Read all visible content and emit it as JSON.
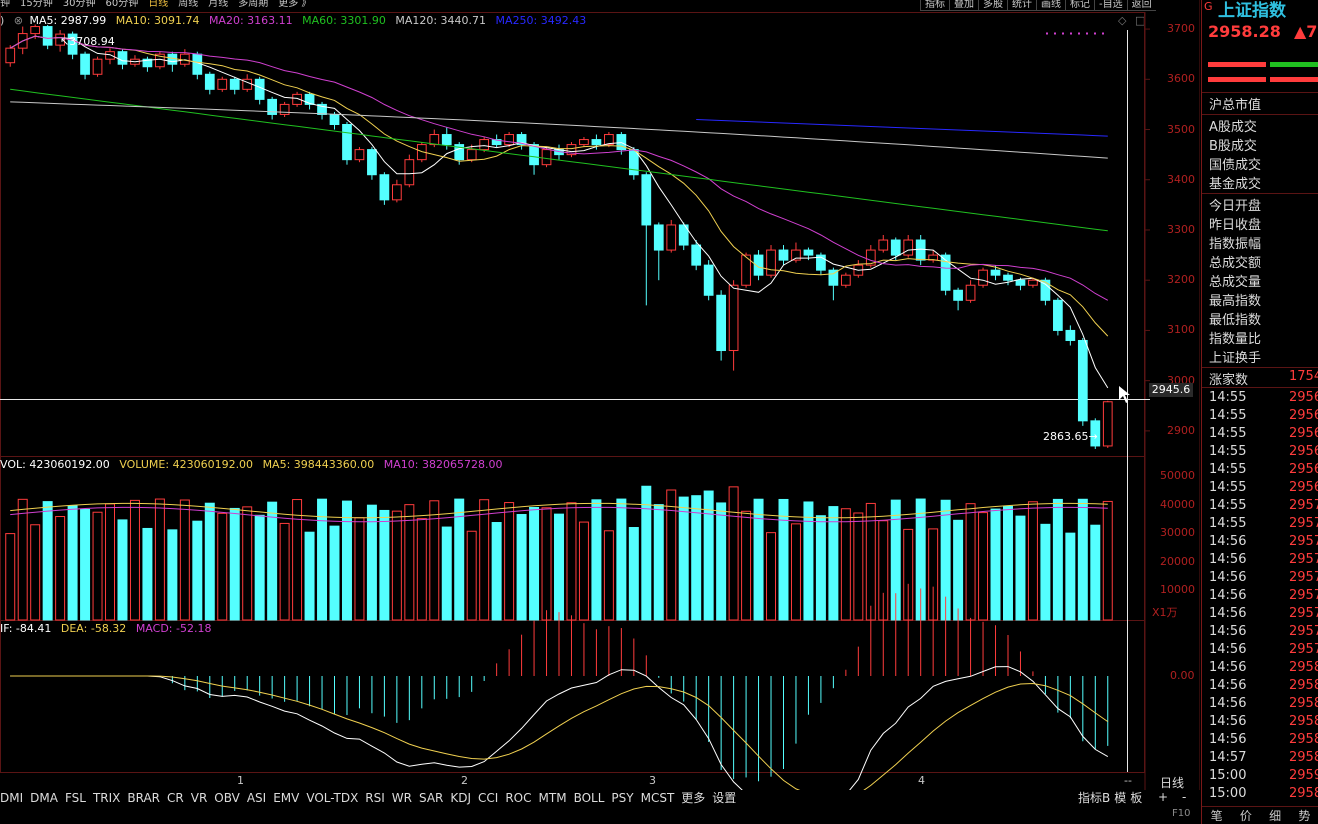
{
  "toolbar": {
    "periods": [
      "钟",
      "15分钟",
      "30分钟",
      "60分钟",
      "日线",
      "周线",
      "月线",
      "多周期",
      "更多 》"
    ],
    "active_period": "日线",
    "right_buttons": [
      "指标",
      "叠加",
      "多股",
      "统计",
      "画线",
      "标记",
      "-自选",
      "返回"
    ]
  },
  "ma_legend": {
    "ma5": "MA5: 2987.99",
    "ma10": "MA10: 3091.74",
    "ma20": "MA20: 3163.11",
    "ma60": "MA60: 3301.90",
    "ma120": "MA120: 3440.71",
    "ma250": "MA250: 3492.43"
  },
  "vol_legend": {
    "vol": "VOL: 423060192.00",
    "volume": "VOLUME: 423060192.00",
    "ma5": "MA5: 398443360.00",
    "ma10": "MA10: 382065728.00"
  },
  "macd_legend": {
    "dif": "IF: -84.41",
    "dea": "DEA: -58.32",
    "macd": "MACD: -52.18"
  },
  "price_axis": [
    "3700",
    "3600",
    "3500",
    "3400",
    "3300",
    "3200",
    "3100",
    "3000",
    "2900"
  ],
  "vol_axis": [
    "50000",
    "40000",
    "30000",
    "20000",
    "10000"
  ],
  "vol_unit": "X1万",
  "macd_axis": "0.00",
  "crosshair_value": "2945.6",
  "annotation_high": "3708.94",
  "annotation_low": "2863.65",
  "month_labels": [
    "1",
    "2",
    "3",
    "4"
  ],
  "period_button": "日线",
  "nav_buttons": [
    "--",
    "+",
    "-"
  ],
  "panel": {
    "title": "上证指数",
    "price": "2958.28",
    "change": "▲7",
    "labels_a": [
      "沪总市值"
    ],
    "labels_b": [
      "A股成交",
      "B股成交",
      "国债成交",
      "基金成交"
    ],
    "labels_c": [
      "今日开盘",
      "昨日收盘",
      "指数振幅",
      "总成交额",
      "总成交量",
      "最高指数",
      "最低指数",
      "指数量比",
      "上证换手"
    ],
    "rise_label": "涨家数",
    "rise_value": "1754",
    "ticks": [
      {
        "t": "14:55",
        "v": "2956"
      },
      {
        "t": "14:55",
        "v": "2956"
      },
      {
        "t": "14:55",
        "v": "2956"
      },
      {
        "t": "14:55",
        "v": "2956"
      },
      {
        "t": "14:55",
        "v": "2956"
      },
      {
        "t": "14:55",
        "v": "2956"
      },
      {
        "t": "14:55",
        "v": "2957"
      },
      {
        "t": "14:55",
        "v": "2957"
      },
      {
        "t": "14:56",
        "v": "2957"
      },
      {
        "t": "14:56",
        "v": "2957"
      },
      {
        "t": "14:56",
        "v": "2957"
      },
      {
        "t": "14:56",
        "v": "2957"
      },
      {
        "t": "14:56",
        "v": "2957"
      },
      {
        "t": "14:56",
        "v": "2957"
      },
      {
        "t": "14:56",
        "v": "2957"
      },
      {
        "t": "14:56",
        "v": "2958"
      },
      {
        "t": "14:56",
        "v": "2958"
      },
      {
        "t": "14:56",
        "v": "2958"
      },
      {
        "t": "14:56",
        "v": "2958"
      },
      {
        "t": "14:56",
        "v": "2958"
      },
      {
        "t": "14:57",
        "v": "2958"
      },
      {
        "t": "15:00",
        "v": "2959"
      },
      {
        "t": "15:00",
        "v": "2958"
      }
    ],
    "tabs": [
      "笔",
      "价",
      "细",
      "势"
    ]
  },
  "indicator_tabs": [
    "DMI",
    "DMA",
    "FSL",
    "TRIX",
    "BRAR",
    "CR",
    "VR",
    "OBV",
    "ASI",
    "EMV",
    "VOL-TDX",
    "RSI",
    "WR",
    "SAR",
    "KDJ",
    "CCI",
    "ROC",
    "MTM",
    "BOLL",
    "PSY",
    "MCST",
    "更多",
    "设置"
  ],
  "indicator_buttons": [
    "指标B",
    "模",
    "板"
  ],
  "f10": "F10",
  "colors": {
    "up": "#ff3c3c",
    "down": "#54ffff",
    "ma5": "#ffffff",
    "ma10": "#f0d050",
    "ma20": "#d040d0",
    "ma60": "#20c020",
    "ma120": "#c8c8c8",
    "ma250": "#2828ff"
  },
  "chart_data": {
    "type": "candlestick",
    "note_series": "daily K-line, index points",
    "candles": [
      [
        3633,
        3662,
        3625,
        3668
      ],
      [
        3662,
        3691,
        3650,
        3705
      ],
      [
        3691,
        3705,
        3680,
        3709
      ],
      [
        3705,
        3668,
        3660,
        3708
      ],
      [
        3668,
        3690,
        3655,
        3698
      ],
      [
        3690,
        3650,
        3640,
        3695
      ],
      [
        3650,
        3610,
        3600,
        3655
      ],
      [
        3610,
        3640,
        3605,
        3645
      ],
      [
        3640,
        3655,
        3630,
        3662
      ],
      [
        3655,
        3630,
        3620,
        3660
      ],
      [
        3630,
        3640,
        3625,
        3648
      ],
      [
        3640,
        3625,
        3615,
        3645
      ],
      [
        3625,
        3650,
        3620,
        3655
      ],
      [
        3650,
        3630,
        3615,
        3655
      ],
      [
        3630,
        3650,
        3625,
        3660
      ],
      [
        3650,
        3610,
        3600,
        3655
      ],
      [
        3610,
        3580,
        3570,
        3615
      ],
      [
        3580,
        3600,
        3575,
        3605
      ],
      [
        3600,
        3580,
        3570,
        3605
      ],
      [
        3580,
        3600,
        3575,
        3610
      ],
      [
        3600,
        3560,
        3550,
        3605
      ],
      [
        3560,
        3530,
        3520,
        3565
      ],
      [
        3530,
        3550,
        3525,
        3555
      ],
      [
        3550,
        3570,
        3545,
        3575
      ],
      [
        3570,
        3550,
        3540,
        3575
      ],
      [
        3550,
        3530,
        3520,
        3555
      ],
      [
        3530,
        3510,
        3500,
        3535
      ],
      [
        3510,
        3440,
        3430,
        3515
      ],
      [
        3440,
        3460,
        3435,
        3465
      ],
      [
        3460,
        3410,
        3400,
        3465
      ],
      [
        3410,
        3360,
        3350,
        3415
      ],
      [
        3360,
        3390,
        3355,
        3400
      ],
      [
        3390,
        3440,
        3385,
        3450
      ],
      [
        3440,
        3470,
        3435,
        3475
      ],
      [
        3470,
        3490,
        3465,
        3500
      ],
      [
        3490,
        3470,
        3460,
        3505
      ],
      [
        3470,
        3440,
        3430,
        3475
      ],
      [
        3440,
        3460,
        3435,
        3470
      ],
      [
        3460,
        3480,
        3455,
        3485
      ],
      [
        3480,
        3470,
        3465,
        3490
      ],
      [
        3470,
        3490,
        3465,
        3495
      ],
      [
        3490,
        3470,
        3460,
        3495
      ],
      [
        3470,
        3430,
        3410,
        3475
      ],
      [
        3430,
        3460,
        3425,
        3465
      ],
      [
        3460,
        3450,
        3440,
        3470
      ],
      [
        3450,
        3470,
        3445,
        3475
      ],
      [
        3470,
        3480,
        3465,
        3485
      ],
      [
        3480,
        3470,
        3460,
        3490
      ],
      [
        3470,
        3490,
        3465,
        3495
      ],
      [
        3490,
        3460,
        3450,
        3495
      ],
      [
        3460,
        3410,
        3400,
        3465
      ],
      [
        3410,
        3310,
        3150,
        3415
      ],
      [
        3310,
        3260,
        3200,
        3315
      ],
      [
        3260,
        3310,
        3255,
        3320
      ],
      [
        3310,
        3270,
        3260,
        3315
      ],
      [
        3270,
        3230,
        3220,
        3280
      ],
      [
        3230,
        3170,
        3160,
        3240
      ],
      [
        3170,
        3060,
        3040,
        3180
      ],
      [
        3060,
        3190,
        3020,
        3200
      ],
      [
        3190,
        3250,
        3185,
        3255
      ],
      [
        3250,
        3210,
        3200,
        3260
      ],
      [
        3210,
        3260,
        3205,
        3270
      ],
      [
        3260,
        3240,
        3230,
        3270
      ],
      [
        3240,
        3260,
        3235,
        3275
      ],
      [
        3260,
        3250,
        3240,
        3265
      ],
      [
        3250,
        3220,
        3210,
        3255
      ],
      [
        3220,
        3190,
        3160,
        3225
      ],
      [
        3190,
        3210,
        3185,
        3215
      ],
      [
        3210,
        3230,
        3205,
        3240
      ],
      [
        3230,
        3260,
        3225,
        3270
      ],
      [
        3260,
        3280,
        3255,
        3290
      ],
      [
        3280,
        3250,
        3240,
        3285
      ],
      [
        3250,
        3280,
        3245,
        3290
      ],
      [
        3280,
        3240,
        3230,
        3290
      ],
      [
        3240,
        3250,
        3235,
        3260
      ],
      [
        3250,
        3180,
        3170,
        3255
      ],
      [
        3180,
        3160,
        3140,
        3185
      ],
      [
        3160,
        3190,
        3155,
        3200
      ],
      [
        3190,
        3220,
        3185,
        3225
      ],
      [
        3220,
        3210,
        3200,
        3230
      ],
      [
        3210,
        3200,
        3190,
        3215
      ],
      [
        3200,
        3190,
        3180,
        3205
      ],
      [
        3190,
        3200,
        3185,
        3205
      ],
      [
        3200,
        3160,
        3150,
        3205
      ],
      [
        3160,
        3100,
        3090,
        3165
      ],
      [
        3100,
        3080,
        3070,
        3110
      ],
      [
        3080,
        2920,
        2910,
        3085
      ],
      [
        2920,
        2870,
        2864,
        2925
      ],
      [
        2870,
        2958,
        2866,
        2960
      ]
    ],
    "x_labels": [
      "1",
      "2",
      "3",
      "4"
    ],
    "ylim": [
      2850,
      3730
    ]
  }
}
